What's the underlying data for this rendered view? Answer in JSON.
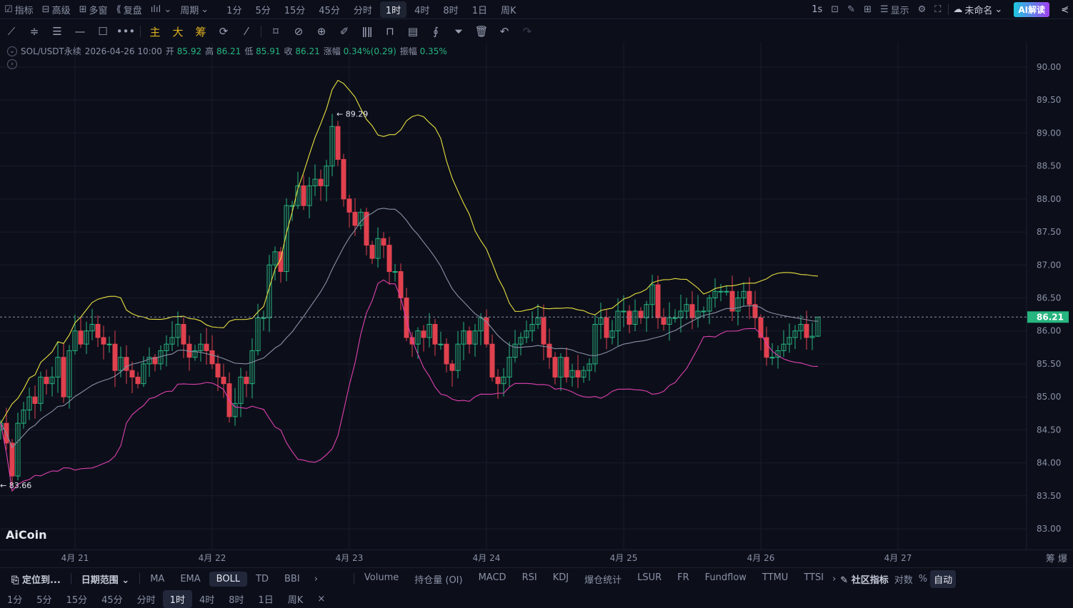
{
  "top": {
    "left": [
      {
        "icon": "chart-icon",
        "label": "指标"
      },
      {
        "icon": "advanced-icon",
        "label": "高级"
      },
      {
        "icon": "multi-window-icon",
        "label": "多窗"
      },
      {
        "icon": "replay-icon",
        "label": "复盘"
      }
    ],
    "period_label": "周期",
    "periods": [
      "1分",
      "5分",
      "15分",
      "45分",
      "分时",
      "1时",
      "4时",
      "8时",
      "1日",
      "周K"
    ],
    "active_period": "1时",
    "right": {
      "refresh": "1s",
      "display": "显示",
      "layout_name": "未命名",
      "ai": "AI解读"
    }
  },
  "tools": {
    "main": "主",
    "big": "大",
    "chip": "筹"
  },
  "info": {
    "symbol": "SOL/USDT永续",
    "time": "2026-04-26 10:00",
    "open_label": "开",
    "open": "85.92",
    "high_label": "高",
    "high": "86.21",
    "low_label": "低",
    "low": "85.91",
    "close_label": "收",
    "close": "86.21",
    "change_label": "涨幅",
    "change": "0.34%(0.29)",
    "amp_label": "振幅",
    "amp": "0.35%"
  },
  "logo": "AiCoin",
  "price_axis": {
    "ticks": [
      "90.00",
      "89.50",
      "89.00",
      "88.50",
      "88.00",
      "87.50",
      "87.00",
      "86.50",
      "86.00",
      "85.50",
      "85.00",
      "84.50",
      "84.00",
      "83.50",
      "83.00"
    ],
    "current": "86.21"
  },
  "date_axis": [
    "4月 21",
    "4月 22",
    "4月 23",
    "4月 24",
    "4月 25",
    "4月 26",
    "4月 27"
  ],
  "axis_right": {
    "chip": "筹",
    "liq": "爆"
  },
  "indicators": {
    "locate": "定位到...",
    "date_range": "日期范围",
    "main": [
      "MA",
      "EMA",
      "BOLL",
      "TD",
      "BBI"
    ],
    "active": "BOLL",
    "sub": [
      "Volume",
      "持仓量 (OI)",
      "MACD",
      "RSI",
      "KDJ",
      "爆仓统计",
      "LSUR",
      "FR",
      "Fundflow",
      "TTMU",
      "TTSI"
    ],
    "community": "社区指标",
    "log": "对数",
    "pct": "%",
    "auto": "自动"
  },
  "bottom_periods": [
    "1分",
    "5分",
    "15分",
    "45分",
    "分时",
    "1时",
    "4时",
    "8时",
    "1日",
    "周K"
  ],
  "bottom_close": "×",
  "chart_data": {
    "type": "candlestick",
    "interval": "1h",
    "first_open": 84.5,
    "closes": [
      84.6,
      84.3,
      83.8,
      84.6,
      84.8,
      85.0,
      84.9,
      85.3,
      85.2,
      85.3,
      85.6,
      85.0,
      85.7,
      86.0,
      85.8,
      86.0,
      86.1,
      85.9,
      85.8,
      85.8,
      85.4,
      85.6,
      85.4,
      85.3,
      85.2,
      85.5,
      85.6,
      85.5,
      85.7,
      85.8,
      85.9,
      86.1,
      85.8,
      85.6,
      85.7,
      85.8,
      85.7,
      85.5,
      85.3,
      85.2,
      84.7,
      84.9,
      85.3,
      85.2,
      85.7,
      86.2,
      86.2,
      87.0,
      87.2,
      86.9,
      87.9,
      87.9,
      88.2,
      87.9,
      88.2,
      88.3,
      88.2,
      88.5,
      89.1,
      88.6,
      88.0,
      87.8,
      87.6,
      87.8,
      87.3,
      87.1,
      87.4,
      87.3,
      86.9,
      86.9,
      86.5,
      85.9,
      85.8,
      86.0,
      85.9,
      86.1,
      85.8,
      85.8,
      85.5,
      85.4,
      85.8,
      86.0,
      85.8,
      86.0,
      86.2,
      85.8,
      85.3,
      85.2,
      85.3,
      85.6,
      85.8,
      85.9,
      86.0,
      86.1,
      86.2,
      85.8,
      85.6,
      85.3,
      85.6,
      85.3,
      85.4,
      85.3,
      85.4,
      85.5,
      86.1,
      86.2,
      85.9,
      86.0,
      86.3,
      86.3,
      86.1,
      86.3,
      86.2,
      86.4,
      86.7,
      86.2,
      86.1,
      86.2,
      86.2,
      86.3,
      86.4,
      86.2,
      86.3,
      86.3,
      86.5,
      86.6,
      86.6,
      86.6,
      86.3,
      86.5,
      86.6,
      86.4,
      86.2,
      85.9,
      85.6,
      85.6,
      85.7,
      85.8,
      85.9,
      86.0,
      86.1,
      85.9,
      85.92,
      86.21
    ],
    "annotations": {
      "max": "89.29",
      "min": "83.66"
    },
    "indicator": "BOLL(20,2)",
    "ylim": [
      82.7,
      90.3
    ],
    "colors": {
      "up": "#27b580",
      "down": "#e0414f",
      "upper": "#e8e040",
      "mid": "#8a90a6",
      "lower": "#e040b0"
    }
  }
}
